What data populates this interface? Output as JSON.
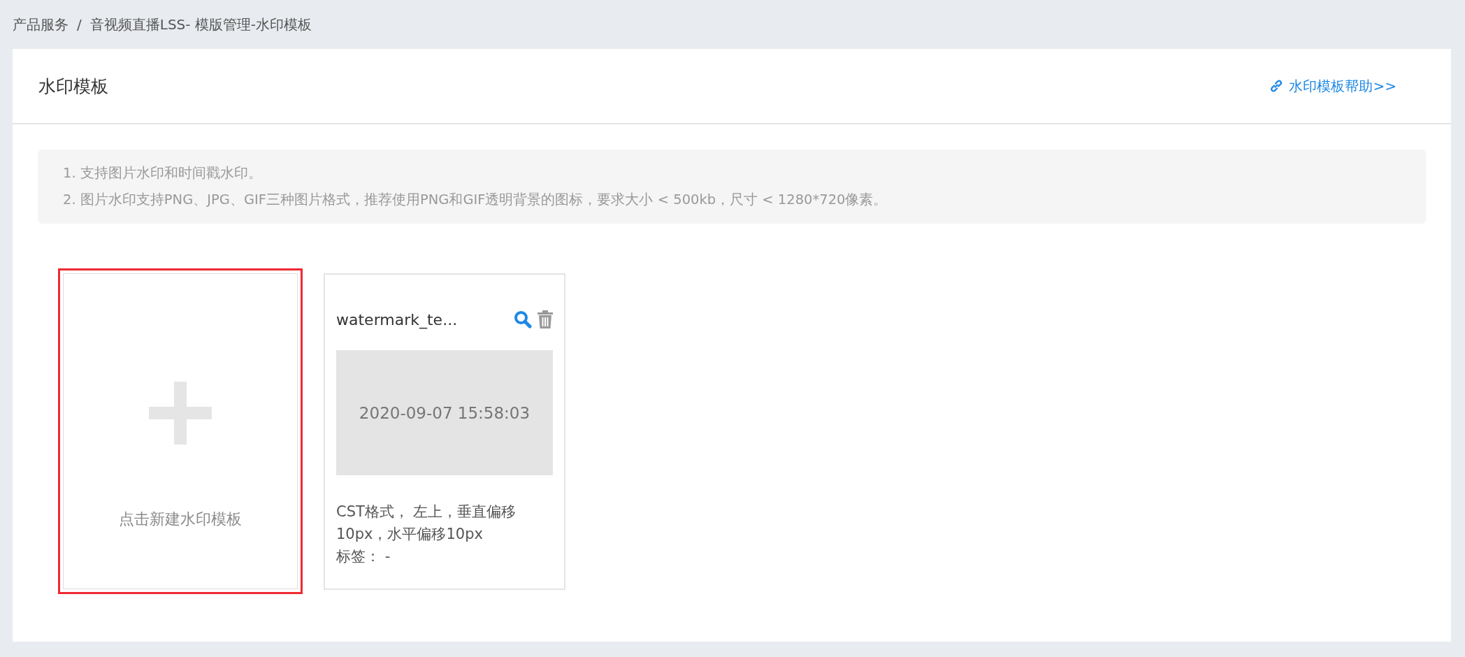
{
  "breadcrumb": [
    {
      "label": "产品服务"
    },
    {
      "label": "音视频直播LSS- 模版管理-水印模板"
    }
  ],
  "breadcrumb_separator": "/",
  "panel": {
    "title": "水印模板",
    "help_link": "水印模板帮助>>"
  },
  "notes": [
    "1. 支持图片水印和时间戳水印。",
    "2. 图片水印支持PNG、JPG、GIF三种图片格式，推荐使用PNG和GIF透明背景的图标，要求大小 < 500kb，尺寸 < 1280*720像素。"
  ],
  "add_card": {
    "label": "点击新建水印模板",
    "highlighted": true
  },
  "templates": [
    {
      "name": "watermark_te...",
      "preview_text": "2020-09-07 15:58:03",
      "description": "CST格式， 左上，垂直偏移10px，水平偏移10px",
      "tags": "标签： -"
    }
  ]
}
